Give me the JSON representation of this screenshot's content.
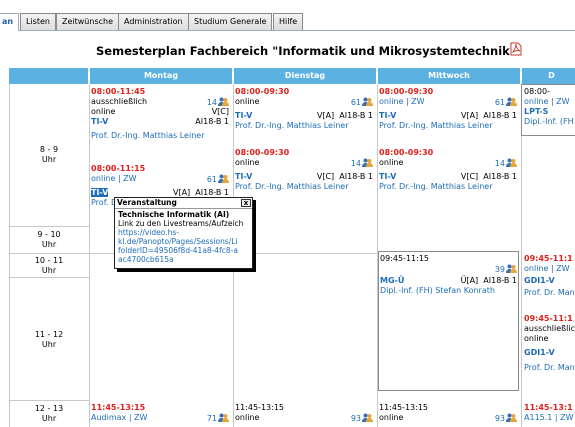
{
  "tabs": [
    {
      "label": "an",
      "active": true
    },
    {
      "label": "Listen"
    },
    {
      "label": "Zeitwünsche"
    },
    {
      "label": "Administration"
    },
    {
      "label": "Studium Generale"
    },
    {
      "label": "Hilfe"
    }
  ],
  "page_title": "Semesterplan  Fachbereich \"Informatik und Mikrosystemtechnik\"",
  "days": [
    "Montag",
    "Dienstag",
    "Mittwoch",
    "D"
  ],
  "times": {
    "t1": [
      "8 - 9",
      "Uhr"
    ],
    "t2": [
      "9 - 10",
      "Uhr"
    ],
    "t3": [
      "10 - 11",
      "Uhr"
    ],
    "t4": [
      "11 - 12",
      "Uhr"
    ],
    "t5": [
      "12 - 13",
      "Uhr"
    ]
  },
  "events": {
    "mo1": {
      "time": "08:00-11:45",
      "count": "14",
      "l1": "ausschließlich",
      "l2": "online",
      "l3r": "V[C]",
      "code": "TI-V",
      "group": "AI18-B 1",
      "lecturer": "Prof. Dr.-Ing. Matthias Leiner"
    },
    "mo2": {
      "time": "08:00-11:15",
      "count": "61",
      "l1": "online | ZW",
      "type": "V[A]",
      "code": "TI-V",
      "group": "AI18-B 1",
      "lecturer": "Prof. Dr"
    },
    "mo3": {
      "time": "11:45-13:15",
      "count": "71",
      "l1": "Audimax | ZW"
    },
    "di1": {
      "time": "08:00-09:30",
      "count": "61",
      "l1": "online",
      "type": "V[A]",
      "code": "TI-V",
      "group": "AI18-B 1",
      "lecturer": "Prof. Dr.-Ing. Matthias Leiner"
    },
    "di2": {
      "time": "08:00-09:30",
      "count": "14",
      "l1": "online",
      "type": "V[C]",
      "code": "TI-V",
      "group": "AI18-B 1",
      "lecturer": "Prof. Dr.-Ing. Matthias Leiner"
    },
    "di3": {
      "time": "11:45-13:15",
      "count": "93",
      "l1": "online"
    },
    "mi1": {
      "time": "08:00-09:30",
      "count": "61",
      "l1": "online | ZW",
      "type": "V[A]",
      "code": "TI-V",
      "group": "AI18-B 1",
      "lecturer": "Prof. Dr.-Ing. Matthias Leiner"
    },
    "mi2": {
      "time": "08:00-09:30",
      "count": "14",
      "l1": "online",
      "type": "V[C]",
      "code": "TI-V",
      "group": "AI18-B 1",
      "lecturer": "Prof. Dr.-Ing. Matthias Leiner"
    },
    "mi3": {
      "time": "09:45-11:15",
      "count": "39",
      "type": "Ü[A]",
      "code": "MG-Ü",
      "group": "AI18-B 1",
      "lecturer": "Dipl.-Inf. (FH) Stefan Konrath"
    },
    "mi4": {
      "time": "11:45-13:15",
      "count": "93",
      "l1": "online"
    },
    "do1": {
      "time": "08:00-",
      "l1": "online | ZW",
      "code": "LPT-S",
      "lecturer": "Dipl.-Inf. (FH"
    },
    "do2": {
      "time": "09:45-11:1",
      "l1": "online | ZW",
      "code": "GDI1-V",
      "lecturer": "Prof. Dr. Man"
    },
    "do3": {
      "time": "09:45-11:1",
      "l1": "ausschließlic",
      "l2": "online",
      "code": "GDI1-V",
      "lecturer": "Prof. Dr. Man"
    },
    "do4": {
      "time": "11:45-13:1",
      "l1": "A115.1 | ZW"
    }
  },
  "popup": {
    "title": "Veranstaltung",
    "close": "x",
    "name": "Technische Informatik (AI)",
    "line1": "Link zu den Livestreams/Aufzeich",
    "link1": "https://video.hs-",
    "link2": "kl.de/Panopto/Pages/Sessions/Li",
    "link3": "folderID=49506f8d-41a8-4fc8-a",
    "link4": "ac4700cb615a"
  },
  "colors": {
    "header": "#5bb2e2",
    "time_red": "#e0231c",
    "link_blue": "#1e6db8"
  }
}
